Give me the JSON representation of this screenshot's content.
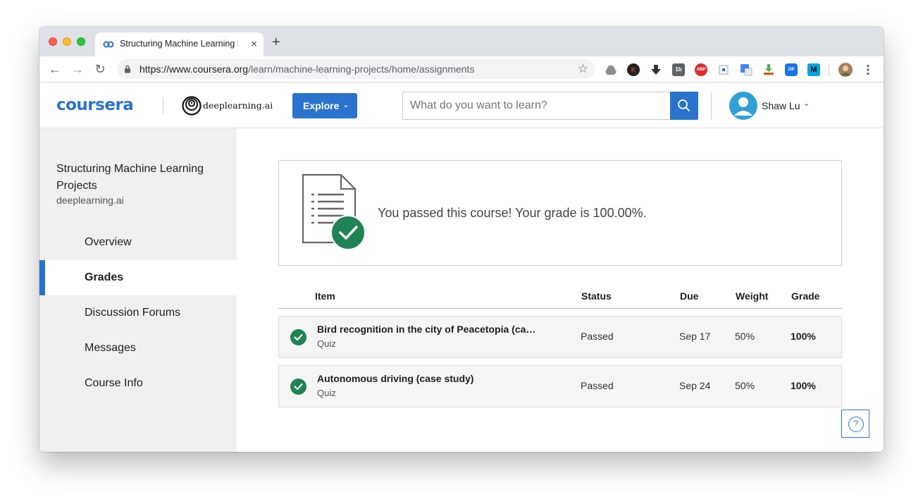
{
  "browser": {
    "tab_title": "Structuring Machine Learning P",
    "url_host": "https://www.coursera.org",
    "url_path": "/learn/machine-learning-projects/home/assignments",
    "new_tab_label": "+",
    "close_label": "×",
    "extensions": [
      "drive-icon",
      "k-icon",
      "download-arrow-icon",
      "1b-icon",
      "abp-icon",
      "screen-icon",
      "translate-icon",
      "download-tray-icon",
      "zip-icon",
      "m-icon",
      "profile-avatar-icon",
      "menu-dots-icon"
    ],
    "ext_labels": {
      "k": "K",
      "onebee": "1b",
      "abp": "ABP",
      "zip": "ZIP",
      "m": "M"
    }
  },
  "header": {
    "logo": "coursera",
    "partner_logo": "deeplearning.ai",
    "explore_label": "Explore",
    "search_placeholder": "What do you want to learn?",
    "user_name": "Shaw Lu"
  },
  "sidebar": {
    "course_title": "Structuring Machine Learning Projects",
    "course_partner": "deeplearning.ai",
    "items": [
      {
        "label": "Overview",
        "active": false
      },
      {
        "label": "Grades",
        "active": true
      },
      {
        "label": "Discussion Forums",
        "active": false
      },
      {
        "label": "Messages",
        "active": false
      },
      {
        "label": "Course Info",
        "active": false
      }
    ]
  },
  "main": {
    "pass_message": "You passed this course! Your grade is 100.00%.",
    "columns": {
      "item": "Item",
      "status": "Status",
      "due": "Due",
      "weight": "Weight",
      "grade": "Grade"
    },
    "rows": [
      {
        "title": "Bird recognition in the city of Peacetopia (ca…",
        "type": "Quiz",
        "status": "Passed",
        "due": "Sep 17",
        "weight": "50%",
        "grade": "100%"
      },
      {
        "title": "Autonomous driving (case study)",
        "type": "Quiz",
        "status": "Passed",
        "due": "Sep 24",
        "weight": "50%",
        "grade": "100%"
      }
    ],
    "help_label": "?"
  },
  "colors": {
    "brand": "#2a73cc",
    "success": "#1f8354",
    "sidebar_bg": "#f0f0f0"
  }
}
